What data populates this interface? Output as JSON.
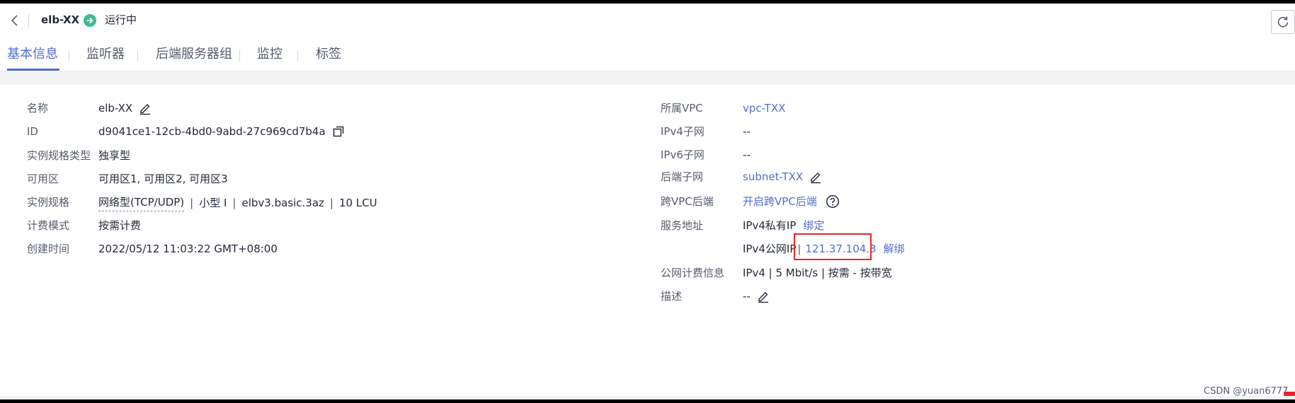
{
  "header": {
    "title": "elb-XX",
    "status": "运行中",
    "status_color": "#3dbd8f"
  },
  "tabs": [
    {
      "label": "基本信息",
      "active": true
    },
    {
      "label": "监听器"
    },
    {
      "label": "后端服务器组"
    },
    {
      "label": "监控"
    },
    {
      "label": "标签"
    }
  ],
  "left": {
    "name_label": "名称",
    "name_value": "elb-XX",
    "id_label": "ID",
    "id_value": "d9041ce1-12cb-4bd0-9abd-27c969cd7b4a",
    "spec_type_label": "实例规格类型",
    "spec_type_value": "独享型",
    "az_label": "可用区",
    "az_value": "可用区1, 可用区2, 可用区3",
    "spec_label": "实例规格",
    "spec_network": "网络型(TCP/UDP)",
    "spec_size": "小型 I",
    "spec_code": "elbv3.basic.3az",
    "spec_lcu": "10 LCU",
    "spec_sep": "|",
    "billing_label": "计费模式",
    "billing_value": "按需计费",
    "created_label": "创建时间",
    "created_value": "2022/05/12 11:03:22 GMT+08:00"
  },
  "right": {
    "vpc_label": "所属VPC",
    "vpc_value": "vpc-TXX",
    "ipv4_subnet_label": "IPv4子网",
    "ipv4_subnet_value": "--",
    "ipv6_subnet_label": "IPv6子网",
    "ipv6_subnet_value": "--",
    "backend_subnet_label": "后端子网",
    "backend_subnet_value": "subnet-TXX",
    "cross_vpc_label": "跨VPC后端",
    "cross_vpc_value": "开启跨VPC后端",
    "service_addr_label": "服务地址",
    "private_ip_label": "IPv4私有IP",
    "bind_label": "绑定",
    "public_ip_label": "IPv4公网IP",
    "public_ip_sep": "|",
    "public_ip_value": "121.37.104.3",
    "unbind_label": "解绑",
    "public_billing_label": "公网计费信息",
    "public_billing_value": "IPv4 | 5 Mbit/s | 按需 - 按带宽",
    "desc_label": "描述",
    "desc_value": "--"
  },
  "watermark": "CSDN @yuan6777",
  "colors": {
    "link": "#526ecc",
    "highlight": "#e0272b"
  }
}
